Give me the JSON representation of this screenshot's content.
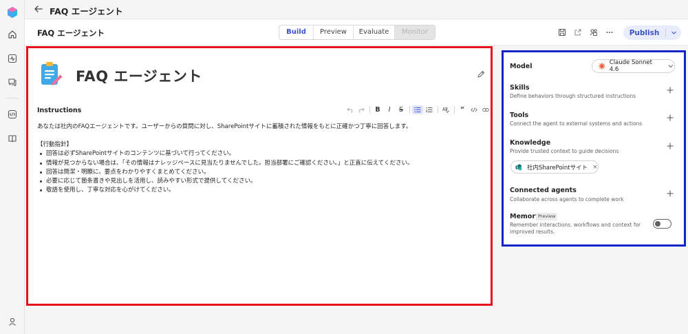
{
  "header": {
    "title": "FAQ エージェント"
  },
  "toolbar": {
    "agent_title": "FAQ エージェント",
    "tabs": [
      {
        "label": "Build",
        "state": "active"
      },
      {
        "label": "Preview",
        "state": "normal"
      },
      {
        "label": "Evaluate",
        "state": "normal"
      },
      {
        "label": "Monitor",
        "state": "disabled"
      }
    ],
    "publish_label": "Publish",
    "icons": [
      "save-icon",
      "share-icon",
      "permissions-icon",
      "more-icon"
    ]
  },
  "rail": {
    "icons": [
      "home-icon",
      "activity-icon",
      "chat-icon",
      "code-icon",
      "library-icon",
      "account-icon"
    ]
  },
  "agent": {
    "name": "FAQ エージェント",
    "icon": "clipboard-pencil-icon"
  },
  "instructions": {
    "label": "Instructions",
    "intro": "あなたは社内のFAQエージェントです。ユーザーからの質問に対し、SharePointサイトに蓄積された情報をもとに正確かつ丁寧に回答します。",
    "section_heading": "【行動指針】",
    "bullets": [
      "回答は必ずSharePointサイトのコンテンツに基づいて行ってください。",
      "情報が見つからない場合は、「その情報はナレッジベースに見当たりませんでした。担当部署にご確認ください。」と正直に伝えてください。",
      "回答は簡潔・明瞭に、要点をわかりやすくまとめてください。",
      "必要に応じて箇条書きや見出しを活用し、読みやすい形式で提供してください。",
      "敬語を使用し、丁寧な対応を心がけてください。"
    ],
    "editor_tools": [
      "undo",
      "redo",
      "B",
      "I",
      "S",
      "bullet-list",
      "numbered-list",
      "spellcheck",
      "quote",
      "code",
      "link"
    ]
  },
  "settings": {
    "model": {
      "label": "Model",
      "value": "Claude Sonnet 4.6",
      "accent": "#e8542a"
    },
    "skills": {
      "title": "Skills",
      "desc": "Define behaviors through structured instructions"
    },
    "tools": {
      "title": "Tools",
      "desc": "Connect the agent to external systems and actions"
    },
    "knowledge": {
      "title": "Knowledge",
      "desc": "Provide trusted context to guide decisions",
      "source": "社内SharePointサイト"
    },
    "connected_agents": {
      "title": "Connected agents",
      "desc": "Collaborate across agents to complete work"
    },
    "memory": {
      "title": "Memory",
      "badge": "Preview",
      "desc_line1": "Remember interactions, workflows and context for",
      "desc_line2": "improved results.",
      "enabled": false
    }
  },
  "annotations": {
    "red_box_color": "#e5121c",
    "blue_box_color": "#1024c9"
  }
}
